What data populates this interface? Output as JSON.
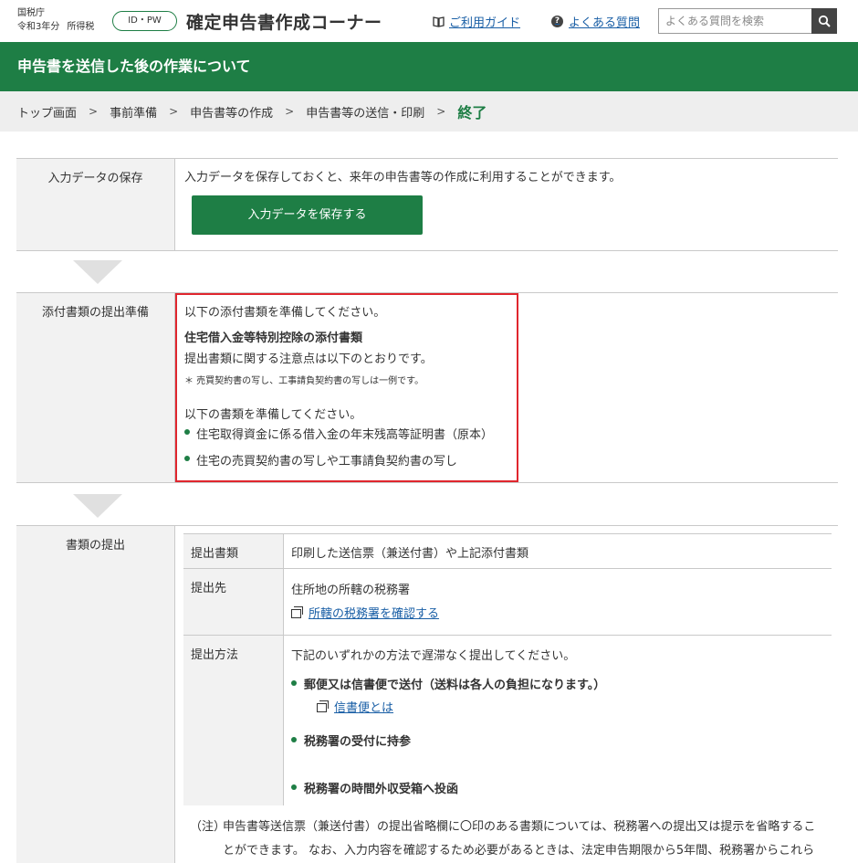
{
  "header": {
    "agency": "国税庁",
    "year": "令和3年分",
    "tax_type": "所得税",
    "idpw_label": "ID・PW",
    "title": "確定申告書作成コーナー",
    "guide_link": "ご利用ガイド",
    "faq_link": "よくある質問",
    "search_placeholder": "よくある質問を検索"
  },
  "page_title": "申告書を送信した後の作業について",
  "breadcrumb": {
    "items": [
      "トップ画面",
      "事前準備",
      "申告書等の作成",
      "申告書等の送信・印刷"
    ],
    "current": "終了"
  },
  "sections": {
    "save": {
      "label": "入力データの保存",
      "text": "入力データを保存しておくと、来年の申告書等の作成に利用することができます。",
      "button": "入力データを保存する"
    },
    "attach": {
      "label": "添付書類の提出準備",
      "intro": "以下の添付書類を準備してください。",
      "heading": "住宅借入金等特別控除の添付書類",
      "note": "提出書類に関する注意点は以下のとおりです。",
      "small_note": "＊ 売買契約書の写し、工事請負契約書の写しは一例です。",
      "prepare": "以下の書類を準備してください。",
      "items": [
        "住宅取得資金に係る借入金の年末残高等証明書（原本）",
        "住宅の売買契約書の写しや工事請負契約書の写し"
      ]
    },
    "submit": {
      "label": "書類の提出",
      "rows": {
        "docs_label": "提出書類",
        "docs_value": "印刷した送信票（兼送付書）や上記添付書類",
        "dest_label": "提出先",
        "dest_value": "住所地の所轄の税務署",
        "dest_link": "所轄の税務署を確認する",
        "method_label": "提出方法",
        "method_intro": "下記のいずれかの方法で遅滞なく提出してください。",
        "method1": "郵便又は信書便で送付（送料は各人の負担になります。）",
        "method1_link": "信書便とは",
        "method2": "税務署の受付に持参",
        "method3": "税務署の時間外収受箱へ投函"
      },
      "note_prefix": "（注）",
      "note_line1": "申告書等送信票（兼送付書）の提出省略欄に〇印のある書類については、税務署への提出又は提示を省略するこ",
      "note_line2": "とができます。 なお、入力内容を確認するため必要があるときは、法定申告期限から5年間、税務署からこれら"
    }
  },
  "colors": {
    "brand_green": "#1e7e45",
    "highlight_red": "#e0262e",
    "link_blue": "#1a5fa6"
  }
}
